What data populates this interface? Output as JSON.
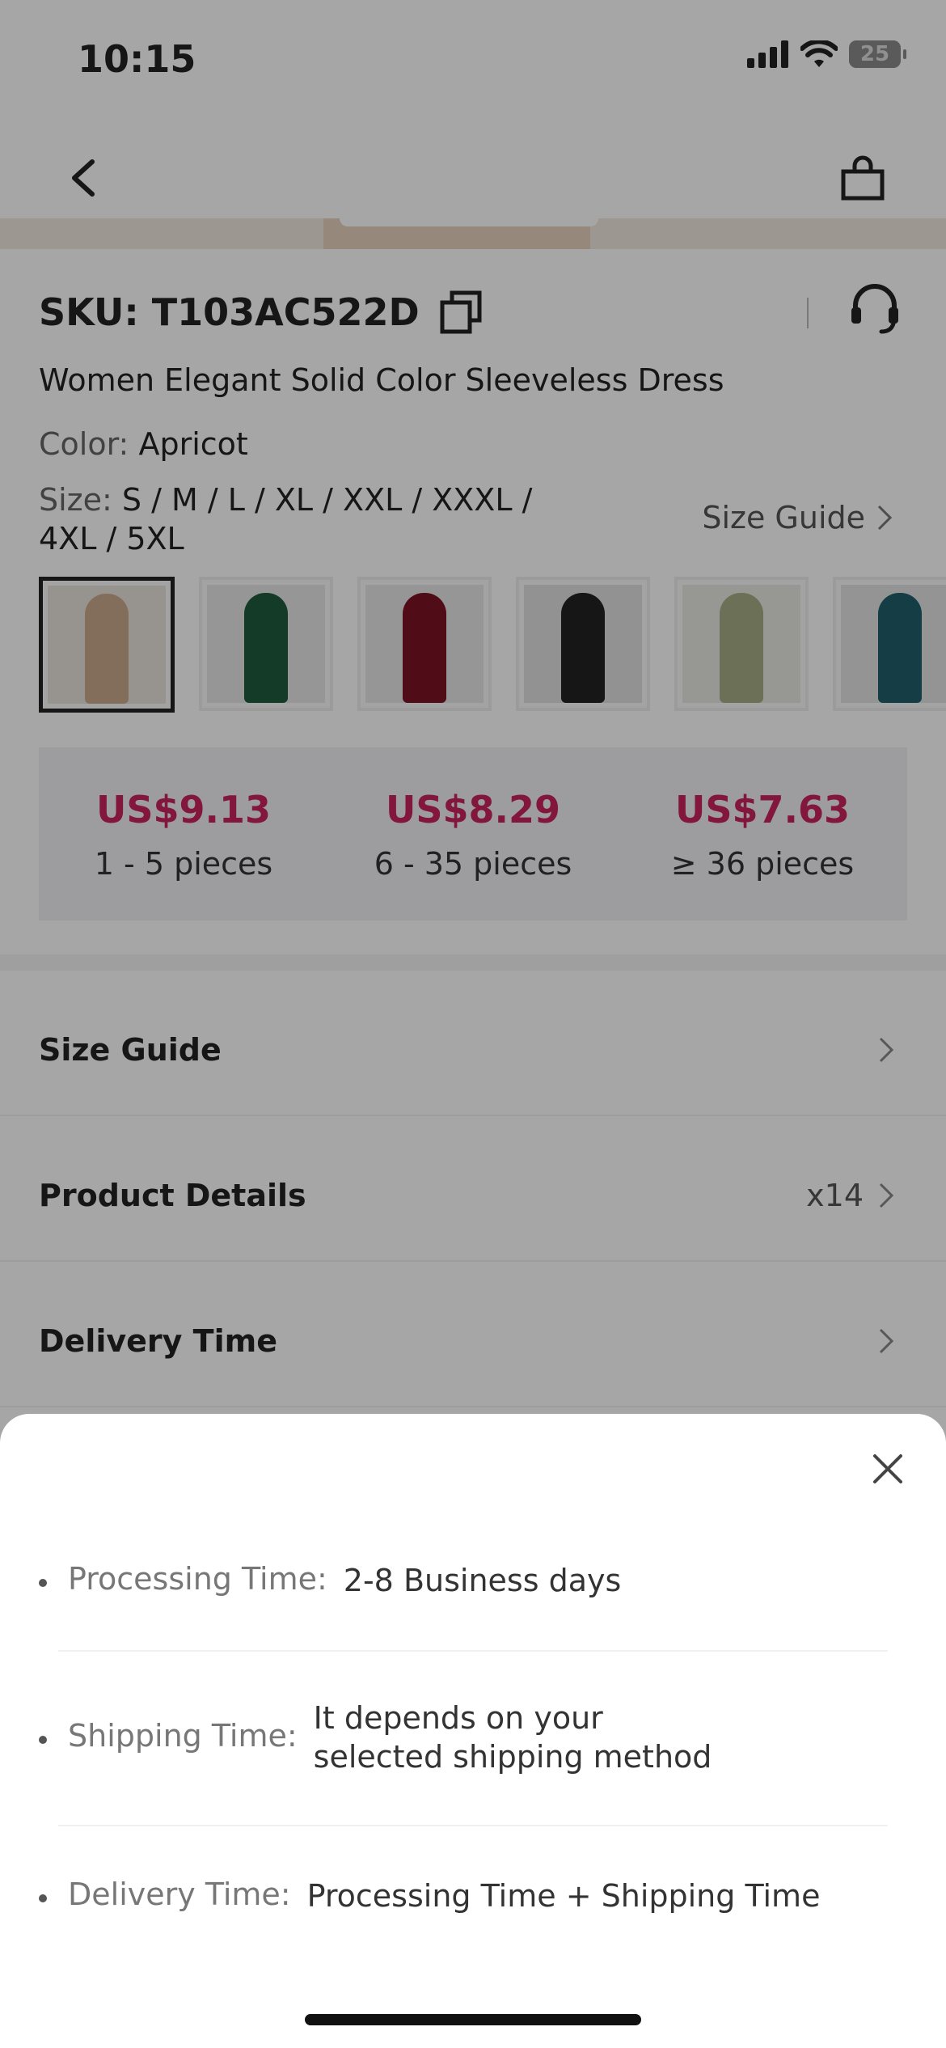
{
  "status_bar": {
    "time": "10:15",
    "battery": "25"
  },
  "product": {
    "sku_label": "SKU: T103AC522D",
    "title": "Women Elegant Solid Color Sleeveless Dress",
    "color_label": "Color:",
    "color_value": "Apricot",
    "size_label": "Size:",
    "size_value": "S / M / L / XL / XXL / XXXL / 4XL / 5XL",
    "size_guide_link": "Size Guide",
    "thumbnails": [
      {
        "name": "apricot",
        "color": "#c9a98c"
      },
      {
        "name": "green",
        "color": "#1f5b3c"
      },
      {
        "name": "burgundy",
        "color": "#7d1424"
      },
      {
        "name": "black",
        "color": "#222222"
      },
      {
        "name": "sage",
        "color": "#a6ad86"
      },
      {
        "name": "teal",
        "color": "#1f5f6c"
      }
    ],
    "price_tiers": [
      {
        "price": "US$9.13",
        "qty": "1 - 5 pieces"
      },
      {
        "price": "US$8.29",
        "qty": "6 - 35 pieces"
      },
      {
        "price": "US$7.63",
        "qty": "≥ 36 pieces"
      }
    ]
  },
  "sections": {
    "size_guide": "Size Guide",
    "product_details": "Product Details",
    "product_details_count": "x14",
    "delivery_time": "Delivery Time"
  },
  "sheet": {
    "processing_label": "Processing Time:",
    "processing_value": "2-8 Business days",
    "shipping_label": "Shipping Time:",
    "shipping_value": "It depends on your selected shipping method",
    "delivery_label": "Delivery Time:",
    "delivery_value": "Processing Time + Shipping Time"
  },
  "colors": {
    "price": "#c8245b",
    "overlay": "rgba(0,0,0,0.35)"
  }
}
